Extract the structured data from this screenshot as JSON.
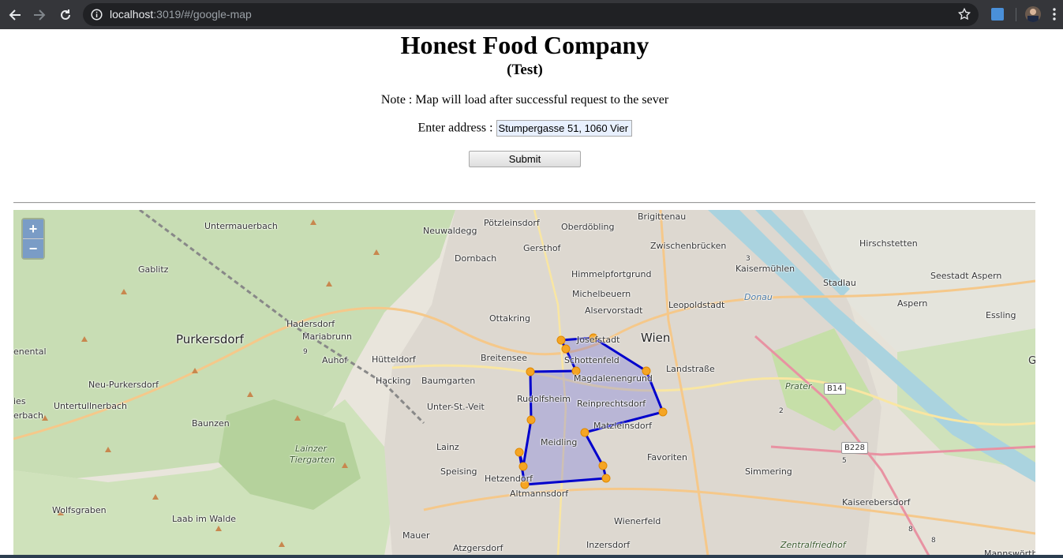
{
  "browser": {
    "url_host": "localhost",
    "url_rest": ":3019/#/google-map"
  },
  "page": {
    "title": "Honest Food Company",
    "subtitle": "(Test)",
    "note": "Note : Map will load after successful request to the sever",
    "address_label": "Enter address :",
    "address_value": "Stumpergasse 51, 1060 Vier",
    "submit_label": "Submit"
  },
  "map": {
    "zoom_in": "+",
    "zoom_out": "−",
    "labels": [
      {
        "text": "Untermauerbach",
        "cls": ""
      },
      {
        "text": "Neuwaldegg",
        "cls": ""
      },
      {
        "text": "Pötzleinsdorf",
        "cls": ""
      },
      {
        "text": "Oberdöbling",
        "cls": ""
      },
      {
        "text": "Brigittenau",
        "cls": ""
      },
      {
        "text": "Gersthof",
        "cls": ""
      },
      {
        "text": "Zwischenbrücken",
        "cls": ""
      },
      {
        "text": "Hirschstetten",
        "cls": ""
      },
      {
        "text": "Gablitz",
        "cls": ""
      },
      {
        "text": "Dornbach",
        "cls": ""
      },
      {
        "text": "Himmelpfortgrund",
        "cls": ""
      },
      {
        "text": "Kaisermühlen",
        "cls": ""
      },
      {
        "text": "Stadlau",
        "cls": ""
      },
      {
        "text": "Seestadt Aspern",
        "cls": ""
      },
      {
        "text": "Michelbeuern",
        "cls": ""
      },
      {
        "text": "Alservorstadt",
        "cls": ""
      },
      {
        "text": "Leopoldstadt",
        "cls": ""
      },
      {
        "text": "Aspern",
        "cls": ""
      },
      {
        "text": "Essling",
        "cls": ""
      },
      {
        "text": "Ottakring",
        "cls": ""
      },
      {
        "text": "Hadersdorf",
        "cls": ""
      },
      {
        "text": "Mariabrunn",
        "cls": ""
      },
      {
        "text": "Purkersdorf",
        "cls": "big"
      },
      {
        "text": "Wien",
        "cls": "big"
      },
      {
        "text": "Josefstadt",
        "cls": ""
      },
      {
        "text": "Auhof",
        "cls": ""
      },
      {
        "text": "Hütteldorf",
        "cls": ""
      },
      {
        "text": "Breitensee",
        "cls": ""
      },
      {
        "text": "Schottenfeld",
        "cls": ""
      },
      {
        "text": "Landstraße",
        "cls": ""
      },
      {
        "text": "Hacking",
        "cls": ""
      },
      {
        "text": "Baumgarten",
        "cls": ""
      },
      {
        "text": "Magdalenengrund",
        "cls": ""
      },
      {
        "text": "Neu-Purkersdorf",
        "cls": ""
      },
      {
        "text": "Prater",
        "cls": "it"
      },
      {
        "text": "Rudolfsheim",
        "cls": ""
      },
      {
        "text": "Untertullnerbach",
        "cls": ""
      },
      {
        "text": "Unter-St.-Veit",
        "cls": ""
      },
      {
        "text": "Reinprechtsdorf",
        "cls": ""
      },
      {
        "text": "Matzleinsdorf",
        "cls": ""
      },
      {
        "text": "Baunzen",
        "cls": ""
      },
      {
        "text": "Lainzer",
        "cls": "it"
      },
      {
        "text": "Tiergarten",
        "cls": "it"
      },
      {
        "text": "Meidling",
        "cls": ""
      },
      {
        "text": "Favoriten",
        "cls": ""
      },
      {
        "text": "Lainz",
        "cls": ""
      },
      {
        "text": "Speising",
        "cls": ""
      },
      {
        "text": "Simmering",
        "cls": ""
      },
      {
        "text": "Hetzendorf",
        "cls": ""
      },
      {
        "text": "Altmannsdorf",
        "cls": ""
      },
      {
        "text": "Kaiserebersdorf",
        "cls": ""
      },
      {
        "text": "Wolfsgraben",
        "cls": ""
      },
      {
        "text": "Laab im Walde",
        "cls": ""
      },
      {
        "text": "Wienerfeld",
        "cls": ""
      },
      {
        "text": "Mauer",
        "cls": ""
      },
      {
        "text": "Inzersdorf",
        "cls": ""
      },
      {
        "text": "Atzgersdorf",
        "cls": ""
      },
      {
        "text": "Zentralfriedhof",
        "cls": "it"
      },
      {
        "text": "Mannswörth",
        "cls": ""
      },
      {
        "text": "Donau",
        "cls": "water"
      },
      {
        "text": "enental",
        "cls": ""
      },
      {
        "text": "ies",
        "cls": ""
      },
      {
        "text": "erbach",
        "cls": ""
      },
      {
        "text": "G",
        "cls": ""
      }
    ],
    "shields": [
      "B14",
      "B228",
      "9",
      "3",
      "2",
      "5",
      "8",
      "8"
    ]
  }
}
